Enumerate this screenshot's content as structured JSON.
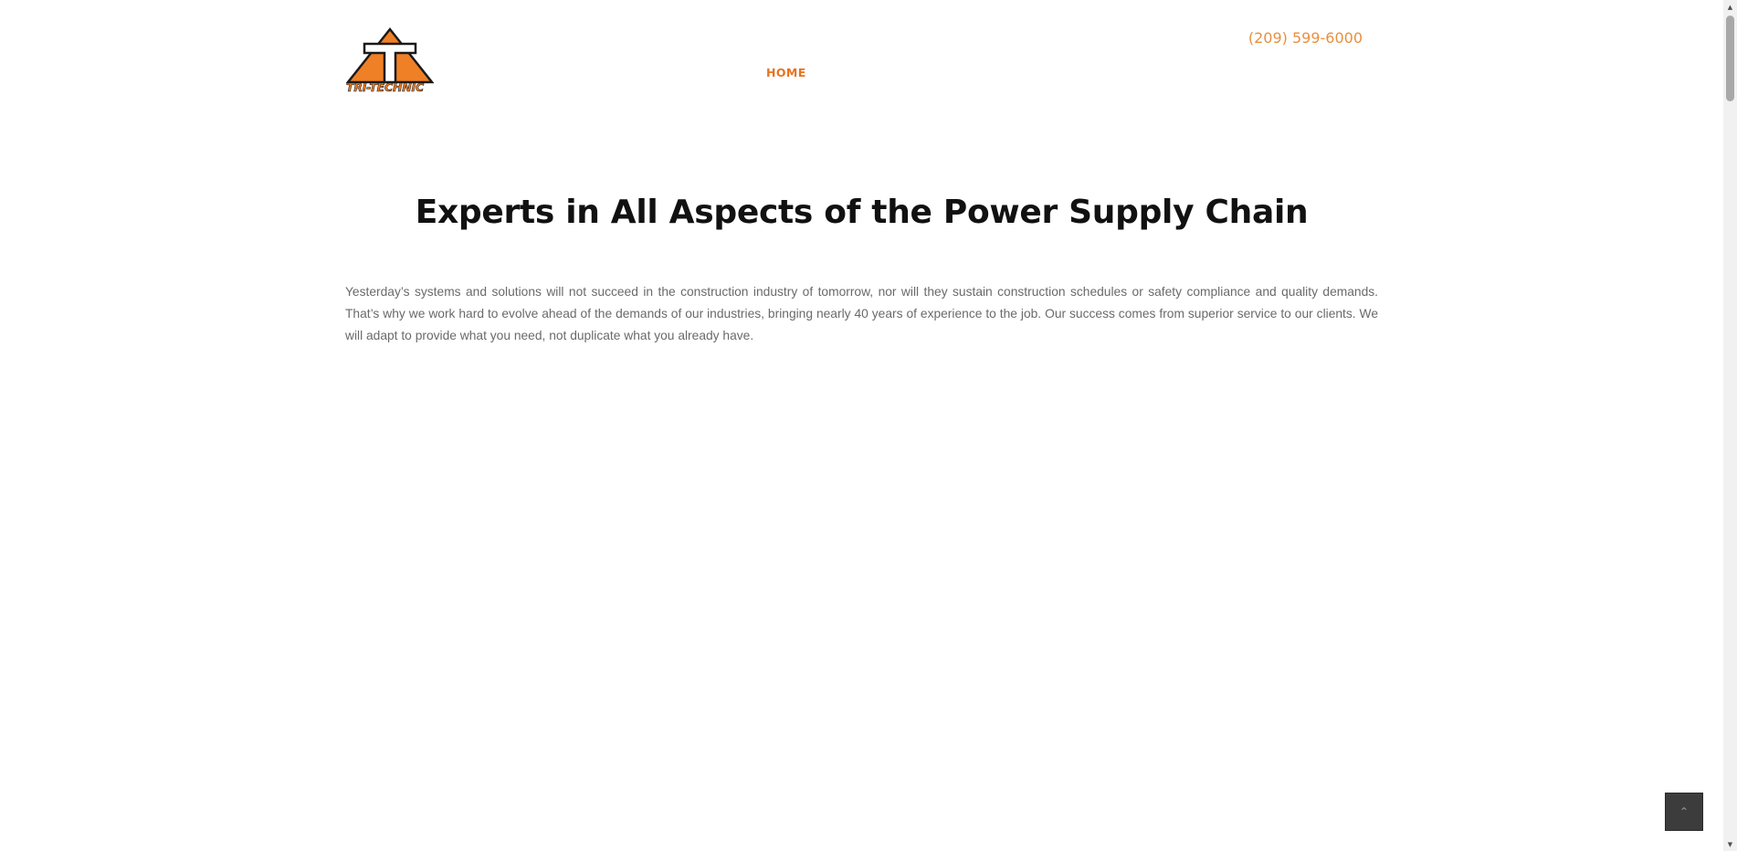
{
  "header": {
    "logo_text": "TRI-TECHNIC",
    "phone": "(209) 599-6000",
    "nav": [
      {
        "label": "HOME",
        "active": true
      }
    ]
  },
  "main": {
    "headline": "Experts in All Aspects of the Power Supply Chain",
    "intro": "Yesterday’s systems and solutions will not succeed in the construction industry of tomorrow, nor will they sustain construction schedules or safety compliance and quality demands. That’s why we work hard to evolve ahead of the demands of our industries, bringing nearly 40 years of experience to the job. Our success comes from superior service to our clients. We will adapt to provide what you need, not duplicate what you already have."
  },
  "colors": {
    "brand_orange": "#f08026",
    "nav_active": "#e8731f",
    "phone": "#e8903f",
    "headline": "#111111",
    "body_text": "#6a6a6a"
  },
  "icons": {
    "scroll_top": "chevron-up-icon",
    "logo_mark": "triangle-t-logo-icon"
  }
}
